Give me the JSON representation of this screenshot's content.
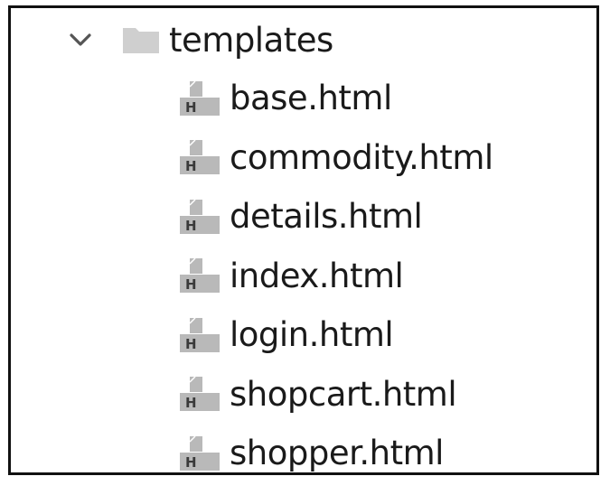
{
  "folder": {
    "name": "templates",
    "expanded": true,
    "chevron_icon": "chevron-down-icon",
    "folder_icon": "folder-icon"
  },
  "files": [
    {
      "name": "base.html",
      "icon": "html-file-icon"
    },
    {
      "name": "commodity.html",
      "icon": "html-file-icon"
    },
    {
      "name": "details.html",
      "icon": "html-file-icon"
    },
    {
      "name": "index.html",
      "icon": "html-file-icon"
    },
    {
      "name": "login.html",
      "icon": "html-file-icon"
    },
    {
      "name": "shopcart.html",
      "icon": "html-file-icon"
    },
    {
      "name": "shopper.html",
      "icon": "html-file-icon"
    }
  ],
  "file_icon_letter": "H",
  "colors": {
    "folder_fill": "#cfcfcf",
    "file_icon_fill": "#b9b9b9",
    "file_icon_dark": "#3a3a3a",
    "chevron": "#555555",
    "text": "#1a1a1a",
    "border": "#111111"
  }
}
